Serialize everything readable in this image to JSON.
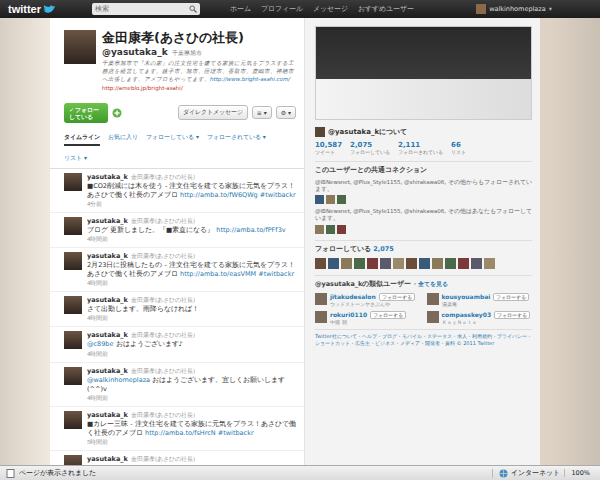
{
  "topbar": {
    "logo": "twitter",
    "search_placeholder": "検索",
    "nav": [
      "ホーム",
      "プロフィール",
      "メッセージ",
      "おすすめユーザー"
    ],
    "user": "walkinhomeplaza",
    "user_caret": "▾"
  },
  "profile": {
    "name": "金田康孝(あさひの社長)",
    "handle": "@yasutaka_k",
    "location": "千葉県旭市",
    "bio": "千葉県旭市で『木の家』の注文住宅を建てる家族に元気をプラスする工務店を経営してます。銚子市、旭市、匝瑳市、香取市、鹿嶋市、神栖市へ出張します。アメブロもやってます。",
    "bio_url": "http://www.bright-asahi.com/",
    "url": "http://ameblo.jp/bright-asahi/"
  },
  "actions": {
    "follow_check": "✓",
    "follow": "フォローしている",
    "dm": "ダイレクトメッセージ",
    "list_menu": "≡ ▾",
    "gear_menu": "⚙ ▾"
  },
  "tabs": [
    {
      "label": "タイムライン",
      "selected": true
    },
    {
      "label": "お気に入り",
      "selected": false
    },
    {
      "label": "フォローしている ▾",
      "selected": false
    },
    {
      "label": "フォローされている ▾",
      "selected": false
    },
    {
      "label": "リスト ▾",
      "selected": false
    }
  ],
  "tweets": [
    {
      "user": "yasutaka_k",
      "name": "金田康孝(あさひの社長)",
      "parts": [
        {
          "kind": "plain",
          "text": "■CO2削減には木を使う - 注文住宅を建てる家族に元気をプラス！あさひで働く社長のアメブロ "
        },
        {
          "kind": "link",
          "text": "http://amba.to/fW6QWg"
        },
        {
          "kind": "plain",
          "text": " "
        },
        {
          "kind": "link",
          "text": "#twitbackr"
        }
      ],
      "time": "4分前"
    },
    {
      "user": "yasutaka_k",
      "name": "金田康孝(あさひの社長)",
      "parts": [
        {
          "kind": "plain",
          "text": "ブログ 更新しました。『■素直になる』 "
        },
        {
          "kind": "link",
          "text": "http://amba.to/fPFf3v"
        }
      ],
      "time": "4時間前"
    },
    {
      "user": "yasutaka_k",
      "name": "金田康孝(あさひの社長)",
      "parts": [
        {
          "kind": "plain",
          "text": "2月23日に投稿したもの - 注文住宅を建てる家族に元気をプラス！あさひで働く社長のアメブロ "
        },
        {
          "kind": "link",
          "text": "http://amba.to/easVMM"
        },
        {
          "kind": "plain",
          "text": " "
        },
        {
          "kind": "link",
          "text": "#twitbackr"
        }
      ],
      "time": "4時間前"
    },
    {
      "user": "yasutaka_k",
      "name": "金田康孝(あさひの社長)",
      "parts": [
        {
          "kind": "plain",
          "text": "さて出勤します。雨降らなければ！"
        }
      ],
      "time": "4時間前"
    },
    {
      "user": "yasutaka_k",
      "name": "金田康孝(あさひの社長)",
      "parts": [
        {
          "kind": "link",
          "text": "@c89be"
        },
        {
          "kind": "plain",
          "text": " おはようございます♪"
        }
      ],
      "time": "4時間前"
    },
    {
      "user": "yasutaka_k",
      "name": "金田康孝(あさひの社長)",
      "parts": [
        {
          "kind": "link",
          "text": "@walkinhomeplaza"
        },
        {
          "kind": "plain",
          "text": " おはようございます。宜しくお願いします(^^)v"
        }
      ],
      "time": "4時間前"
    },
    {
      "user": "yasutaka_k",
      "name": "金田康孝(あさひの社長)",
      "parts": [
        {
          "kind": "plain",
          "text": "■カレー三昧 - 注文住宅を建てる家族に元気をプラス！あさひで働く社長のアメブロ "
        },
        {
          "kind": "link",
          "text": "http://amba.to/fsHrcN"
        },
        {
          "kind": "plain",
          "text": " "
        },
        {
          "kind": "link",
          "text": "#twitbackr"
        }
      ],
      "time": "5時間前"
    },
    {
      "user": "yasutaka_k",
      "name": "金田康孝(あさひの社長)",
      "parts": [],
      "time": ""
    }
  ],
  "sidebar": {
    "about": "@yasutaka_kについて",
    "stats": [
      {
        "value": "10,587",
        "label": "ツイート"
      },
      {
        "value": "2,075",
        "label": "フォローしている"
      },
      {
        "value": "2,111",
        "label": "フォローされている"
      },
      {
        "value": "66",
        "label": "リスト"
      }
    ],
    "connections_title": "このユーザーとの共通コネクション",
    "connections": [
      "@IBNewsnet, @Plus_Style1155, @shirakawa06, その他からもフォローされています。",
      "@IBNewsnet, @Plus_Style1155, @shirakawa06, その他はあなたもフォローしています。"
    ],
    "following_title": "フォローしている",
    "following_count": "2,075",
    "similar_title": "@yasutaka_kの類似ユーザー",
    "similar_all": "· 全てを見る",
    "similar": [
      {
        "handle": "jitakudesalon",
        "name": "ウッドストーンヤさぶんや",
        "button": "フォローする"
      },
      {
        "handle": "kousyouambai",
        "name": "湯楽庵",
        "button": "フォローする"
      },
      {
        "handle": "rokuri0110",
        "name": "中猫 朝",
        "button": "フォローする"
      },
      {
        "handle": "compasskey03",
        "name": "ＫｅｙＮｏｔｅ",
        "button": "フォローする"
      }
    ],
    "footer": "Twitter社について・ヘルプ・ブログ・モバイル・ステータス・求人・利用規約・プライバシー・ショートカット・広告主・ビジネス・メディア・開発者・資料 © 2011 Twitter"
  },
  "status_bar": {
    "text": "ページが表示されました",
    "zone": "インターネット",
    "zoom": "100%"
  }
}
